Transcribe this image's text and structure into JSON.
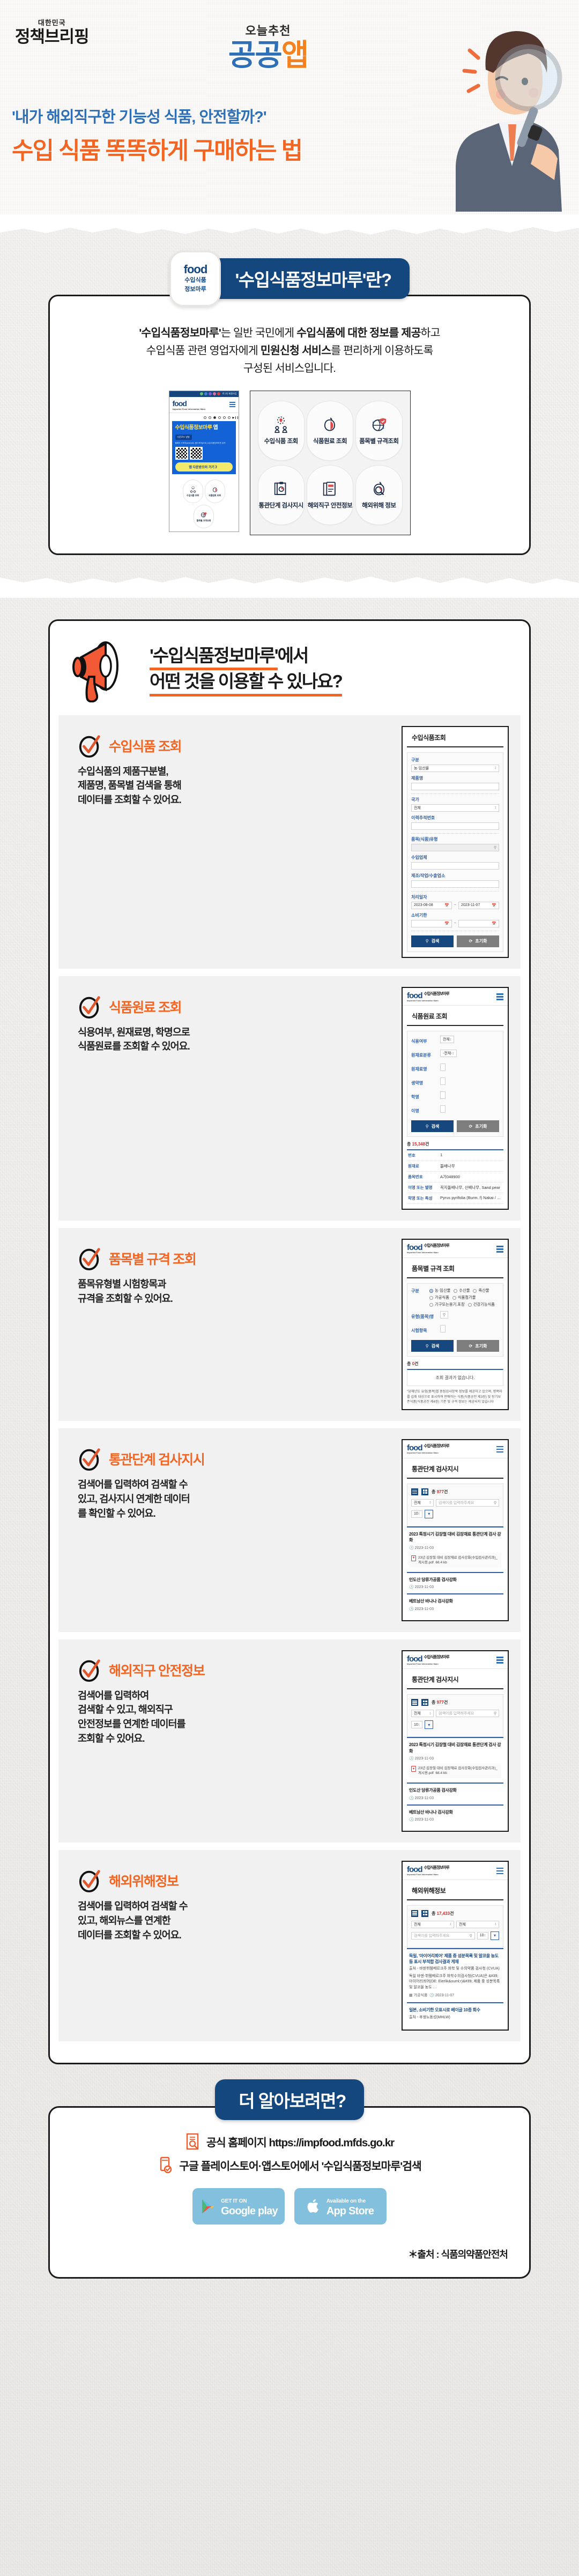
{
  "hero": {
    "brief_small": "대한민국",
    "brief_big": "정책브리핑",
    "today_label": "오늘추천",
    "app_label_1": "공공",
    "app_label_2": "앱",
    "question": "'내가 해외직구한 기능성 식품, 안전할까?'",
    "title": "수입 식품 똑똑하게 구매하는 법",
    "colors": {
      "orange": "#f26522",
      "blue": "#2f6fb5",
      "navy": "#14477e"
    }
  },
  "about": {
    "badge_word": "food",
    "badge_line1": "수입식품",
    "badge_line2": "정보마루",
    "pill_title": "'수입식품정보마루'란?",
    "desc_line1_a": "'수입식품정보마루'",
    "desc_line1_b": "는 일반 국민에게 ",
    "desc_line1_c": "수입식품에 대한 정보를 제공",
    "desc_line1_d": "하고",
    "desc_line2_a": "수입식품 관련 영업자에게 ",
    "desc_line2_b": "민원신청 서비스",
    "desc_line2_c": "를 편리하게 이용하도록",
    "desc_line3": "구성된 서비스입니다.",
    "phone": {
      "logo": "food",
      "logo_sub": "Imported Food Information Maru",
      "logo_title": "수입식품정보마루",
      "banner_title_1": "수입식품정보마루",
      "banner_title_2": "앱",
      "banner_tag": "다운로드 방법",
      "banner_sub": "플레이 스토어(android), 앱스토어(iOS)\n수입식품정보마루 검색",
      "banner_cta": "앱 다운받으러 가기  》",
      "header_links": "로그인 회원가입"
    },
    "icon_grid": [
      {
        "label": "수입식품\n조회",
        "icon": "import-food-icon"
      },
      {
        "label": "식품원료\n조회",
        "icon": "apple-ingredient-icon"
      },
      {
        "label": "품목별\n규격조회",
        "icon": "globe-shield-icon"
      },
      {
        "label": "통관단계\n검사지시",
        "icon": "clipboard-icon"
      },
      {
        "label": "해외직구\n안전정보",
        "icon": "mobile-docs-icon"
      },
      {
        "label": "해외위해\n정보",
        "icon": "apple-magnifier-icon"
      }
    ]
  },
  "features_header": {
    "line1": "'수입식품정보마루'",
    "line1_tail": "에서",
    "line2": "어떤 것을 이용할 수 있나요?",
    "icon": "megaphone-icon"
  },
  "features": [
    {
      "title": "수입식품 조회",
      "desc": "수입식품의 제품구분별,\n제품명, 품목별 검색을 통해\n데이터를 조회할 수 있어요.",
      "screen": {
        "kind": "form",
        "has_app_header": false,
        "screen_title": "수입식품조회",
        "fields": [
          {
            "label": "구분",
            "value": "농·임산물",
            "type": "select"
          },
          {
            "label": "제품명",
            "value": "",
            "type": "text"
          },
          {
            "label": "국가",
            "value": "전체",
            "type": "select"
          },
          {
            "label": "이력추적번호",
            "value": "",
            "type": "text"
          },
          {
            "label": "품목(식품)유형",
            "value": "",
            "type": "search"
          },
          {
            "label": "수입업체",
            "value": "",
            "type": "text"
          },
          {
            "label": "제조/작업/수출업소",
            "value": "",
            "type": "text"
          },
          {
            "label": "처리일자",
            "value": "2023-08-08",
            "value2": "2023-11-07",
            "type": "daterange"
          },
          {
            "label": "소비기한",
            "value": "",
            "value2": "",
            "type": "daterange"
          }
        ],
        "search_button": "검색",
        "reset_button": "초기화"
      }
    },
    {
      "title": "식품원료 조회",
      "desc": "식용여부, 원재료명, 학명으로\n식품원료를 조회할 수 있어요.",
      "screen": {
        "kind": "form-table",
        "has_app_header": true,
        "screen_title": "식품원료 조회",
        "fields": [
          {
            "label": "식용여부",
            "value": "전체",
            "type": "select-inline"
          },
          {
            "label": "원재료분류",
            "value": "-전체-",
            "type": "select-inline"
          },
          {
            "label": "원재료명",
            "value": "",
            "type": "text-inline"
          },
          {
            "label": "생약명",
            "value": "",
            "type": "text-inline"
          },
          {
            "label": "학명",
            "value": "",
            "type": "text-inline"
          },
          {
            "label": "이명",
            "value": "",
            "type": "text-inline"
          }
        ],
        "search_button": "검색",
        "reset_button": "초기화",
        "count_prefix": "총 ",
        "count_value": "15,348",
        "count_suffix": "건",
        "rows": [
          {
            "k": "번호",
            "v": "1"
          },
          {
            "k": "원재료",
            "v": "돌배나무"
          },
          {
            "k": "품목번호",
            "v": "A기048900"
          },
          {
            "k": "이명 또는 별명",
            "v": "꼭지돌배나무, 산배나무, Sand pear"
          },
          {
            "k": "학명 또는 특성",
            "v": "Pyrus pyrifolia (Burm. f) Nakai / Ficus pyr"
          }
        ]
      }
    },
    {
      "title": "품목별 규격 조회",
      "desc": "품목유형별 시험항목과\n규격을 조회할 수 있어요.",
      "screen": {
        "kind": "form-radio",
        "has_app_header": true,
        "screen_title": "품목별 규격 조회",
        "radio_label": "구분",
        "radios": [
          {
            "label": "농·임산물",
            "checked": true
          },
          {
            "label": "수산물",
            "checked": false
          },
          {
            "label": "축산물",
            "checked": false
          },
          {
            "label": "가공식품",
            "checked": false
          },
          {
            "label": "식품첨가물",
            "checked": false
          },
          {
            "label": "기구또는용기.포장",
            "checked": false
          },
          {
            "label": "건강기능식품",
            "checked": false
          }
        ],
        "fields": [
          {
            "label": "유형(품목)명",
            "value": "",
            "type": "search-inline"
          },
          {
            "label": "시험항목",
            "value": "",
            "type": "text-inline"
          }
        ],
        "search_button": "검색",
        "reset_button": "초기화",
        "count_prefix": "총 ",
        "count_value": "0",
        "count_suffix": "건",
        "empty_text": "조회 결과가 없습니다.",
        "note": "\"당해년도 유형(품목)별 중점검사항목 정보를 제공하고 있으며, 명목마를 섭취 대상으로 표시하여 판매하는 식품(식품공전 제3장) 및 장기보존식품(식품공전 제4장) 기준 및 규격 정보는 제공되지 않습니다"
      }
    },
    {
      "title": "통관단계 검사지시",
      "desc": "검색어를 입력하여 검색할 수\n있고, 검사지시 연계한 데이터\n를 확인할 수 있어요.",
      "screen": {
        "kind": "news",
        "has_app_header": true,
        "screen_title": "통관단계 검사지시",
        "count_prefix": "총 ",
        "count_value": "977",
        "count_suffix": "건",
        "filter_value": "전체",
        "search_placeholder": "검색어를 입력하주세요",
        "page_size": "10",
        "items": [
          {
            "title": "2023 특정시기 김장철 대비 김장재료 통관단계 검사 강화",
            "date": "2023-11-03",
            "pdf": "23년 김장철 대비 김장재료 검사강화(수입검사관리과)_게시용.pdf",
            "pdf_size": "68.4 kb"
          },
          {
            "title": "인도산 당류가공품 검사강화",
            "date": "2023-11-03"
          },
          {
            "title": "베트남산 바나나 검사강화",
            "date": "2023-11-03"
          }
        ]
      }
    },
    {
      "title": "해외직구 안전정보",
      "desc": "검색어를 입력하여\n검색할 수 있고, 해외직구\n안전정보를 연계한 데이터를\n조회할 수 있어요.",
      "screen": {
        "kind": "news",
        "has_app_header": true,
        "screen_title": "통관단계 검사지시",
        "count_prefix": "총 ",
        "count_value": "977",
        "count_suffix": "건",
        "filter_value": "전체",
        "search_placeholder": "검색어를 입력하주세요",
        "page_size": "10",
        "items": [
          {
            "title": "2023 특정시기 김장철 대비 김장재료 통관단계 검사 강화",
            "date": "2023-11-03",
            "pdf": "23년 김장철 대비 김장재료 검사강화(수입검사관리과)_게시용.pdf",
            "pdf_size": "68.4 kb"
          },
          {
            "title": "인도산 당류가공품 검사강화",
            "date": "2023-11-03"
          },
          {
            "title": "베트남산 바나나 검사강화",
            "date": "2023-11-03"
          }
        ]
      }
    },
    {
      "title": "해외위해정보",
      "desc": "검색어를 입력하여 검색할 수\n있고, 해외뉴스를 연계한\n데이터를 조회할 수 있어요.",
      "screen": {
        "kind": "news-risk",
        "has_app_header": true,
        "screen_title": "해외위해정보",
        "count_prefix": "총 ",
        "count_value": "17,433",
        "count_suffix": "건",
        "filter_value": "전체",
        "filter_value2": "전체",
        "search_placeholder": "검색어를 입력하주세요",
        "page_size": "10",
        "items": [
          {
            "title": "독일, '아이어리푀어' 제품 중 성분목록 및 알코올 농도 등 표시 부적합 검사결과 게재",
            "source": "출처 - 바덴뷔템베르크주 화학 및 수의약품 검사청 (CVUA)",
            "body": "독일 바덴-뷔템베르크주 화학수의검사청(CVUA)은 &#39;아이어리쾨어(DE: Eierlik&ouml;r)&#39; 제품 중 성분목록 및 알코올 농도 …",
            "category": "가공식품",
            "date": "2023-11-07"
          },
          {
            "title": "일본, 소비기한 오표시로 베이글 10종 회수",
            "source": "출처 - 후생노동성(MHLW)"
          }
        ]
      }
    }
  ],
  "footer": {
    "pill": "더 알아보려면?",
    "homepage_label": "공식 홈페이지 https://impfood.mfds.go.kr",
    "store_label": "구글 플레이스토어·앱스토어에서 '수입식품정보마루'검색",
    "google": {
      "l1": "GET IT ON",
      "l2": "Google play"
    },
    "apple": {
      "l1": "Available on the",
      "l2": "App Store"
    },
    "source": "＊출처 : 식품의약품안전처"
  }
}
